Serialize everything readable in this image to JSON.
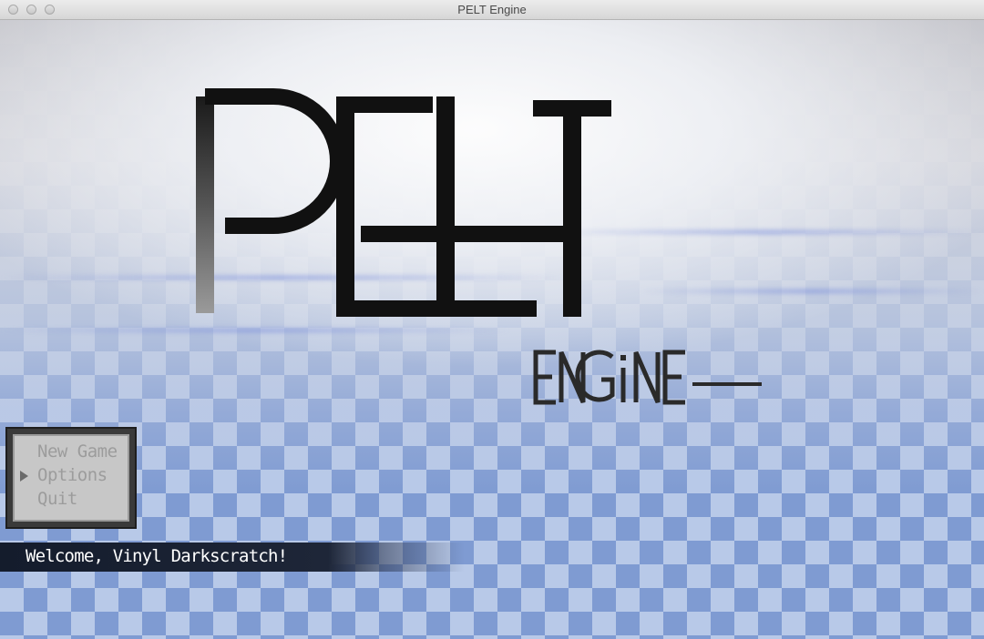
{
  "window": {
    "title": "PELT Engine"
  },
  "logo": {
    "main_text": "PELT",
    "sub_text": "ENGINE"
  },
  "menu": {
    "items": [
      "New Game",
      "Options",
      "Quit"
    ],
    "selected_index": 1
  },
  "welcome": {
    "text": "Welcome, Vinyl Darkscratch!"
  },
  "colors": {
    "checker_light": "#b8c9e8",
    "checker_dark": "#7f9bd2",
    "menu_text": "#9c9c9c",
    "welcome_bg": "#141c2c"
  }
}
